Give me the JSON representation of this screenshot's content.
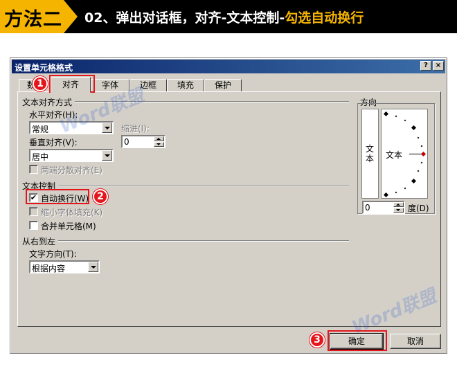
{
  "banner": {
    "tag": "方法二",
    "step_prefix": "02、弹出对话框，对齐-文本控制-",
    "step_highlight": "勾选自动换行"
  },
  "dialog": {
    "title": "设置单元格格式",
    "help_btn": "?",
    "close_btn": "×",
    "tabs": [
      "数字",
      "对齐",
      "字体",
      "边框",
      "填充",
      "保护"
    ],
    "active_tab": "对齐",
    "text_alignment": {
      "group_label": "文本对齐方式",
      "horizontal_label": "水平对齐(H):",
      "horizontal_value": "常规",
      "indent_label": "缩进(I):",
      "indent_value": "0",
      "vertical_label": "垂直对齐(V):",
      "vertical_value": "居中",
      "justify_distributed_label": "两端分散对齐(E)"
    },
    "text_control": {
      "group_label": "文本控制",
      "wrap_text_label": "自动换行(W)",
      "wrap_text_checked": true,
      "shrink_to_fit_label": "缩小字体填充(K)",
      "merge_cells_label": "合并单元格(M)"
    },
    "rtl": {
      "group_label": "从右到左",
      "direction_label": "文字方向(T):",
      "direction_value": "根据内容"
    },
    "orientation": {
      "group_label": "方向",
      "vertical_text": "文本",
      "dial_text": "文本",
      "degrees_value": "0",
      "degrees_label": "度(D)"
    },
    "ok_label": "确定",
    "cancel_label": "取消"
  },
  "annotations": {
    "badge_1": "1",
    "badge_2": "2",
    "badge_3": "3"
  },
  "watermark_text": "Word联盟",
  "colors": {
    "banner_accent": "#f5b400",
    "annotation_red": "#e4161c",
    "titlebar": "#0a246a",
    "dialog_bg": "#d4d0c8"
  }
}
